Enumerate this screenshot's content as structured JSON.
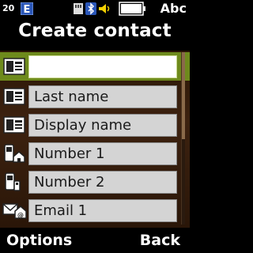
{
  "status": {
    "time": "20",
    "input_mode": "Abc"
  },
  "title": "Create contact",
  "fields": [
    {
      "icon": "first-name-card-icon",
      "label": "",
      "selected": true
    },
    {
      "icon": "last-name-card-icon",
      "label": "Last name"
    },
    {
      "icon": "display-name-card-icon",
      "label": "Display name"
    },
    {
      "icon": "home-phone-icon",
      "label": "Number 1"
    },
    {
      "icon": "mobile-phone-icon",
      "label": "Number 2"
    },
    {
      "icon": "home-email-icon",
      "label": "Email 1"
    }
  ],
  "softkeys": {
    "left": "Options",
    "right": "Back"
  },
  "colors": {
    "selected_row": "#6e8a1c",
    "list_background": "#3d2210",
    "field_background": "#d4d4d4"
  }
}
